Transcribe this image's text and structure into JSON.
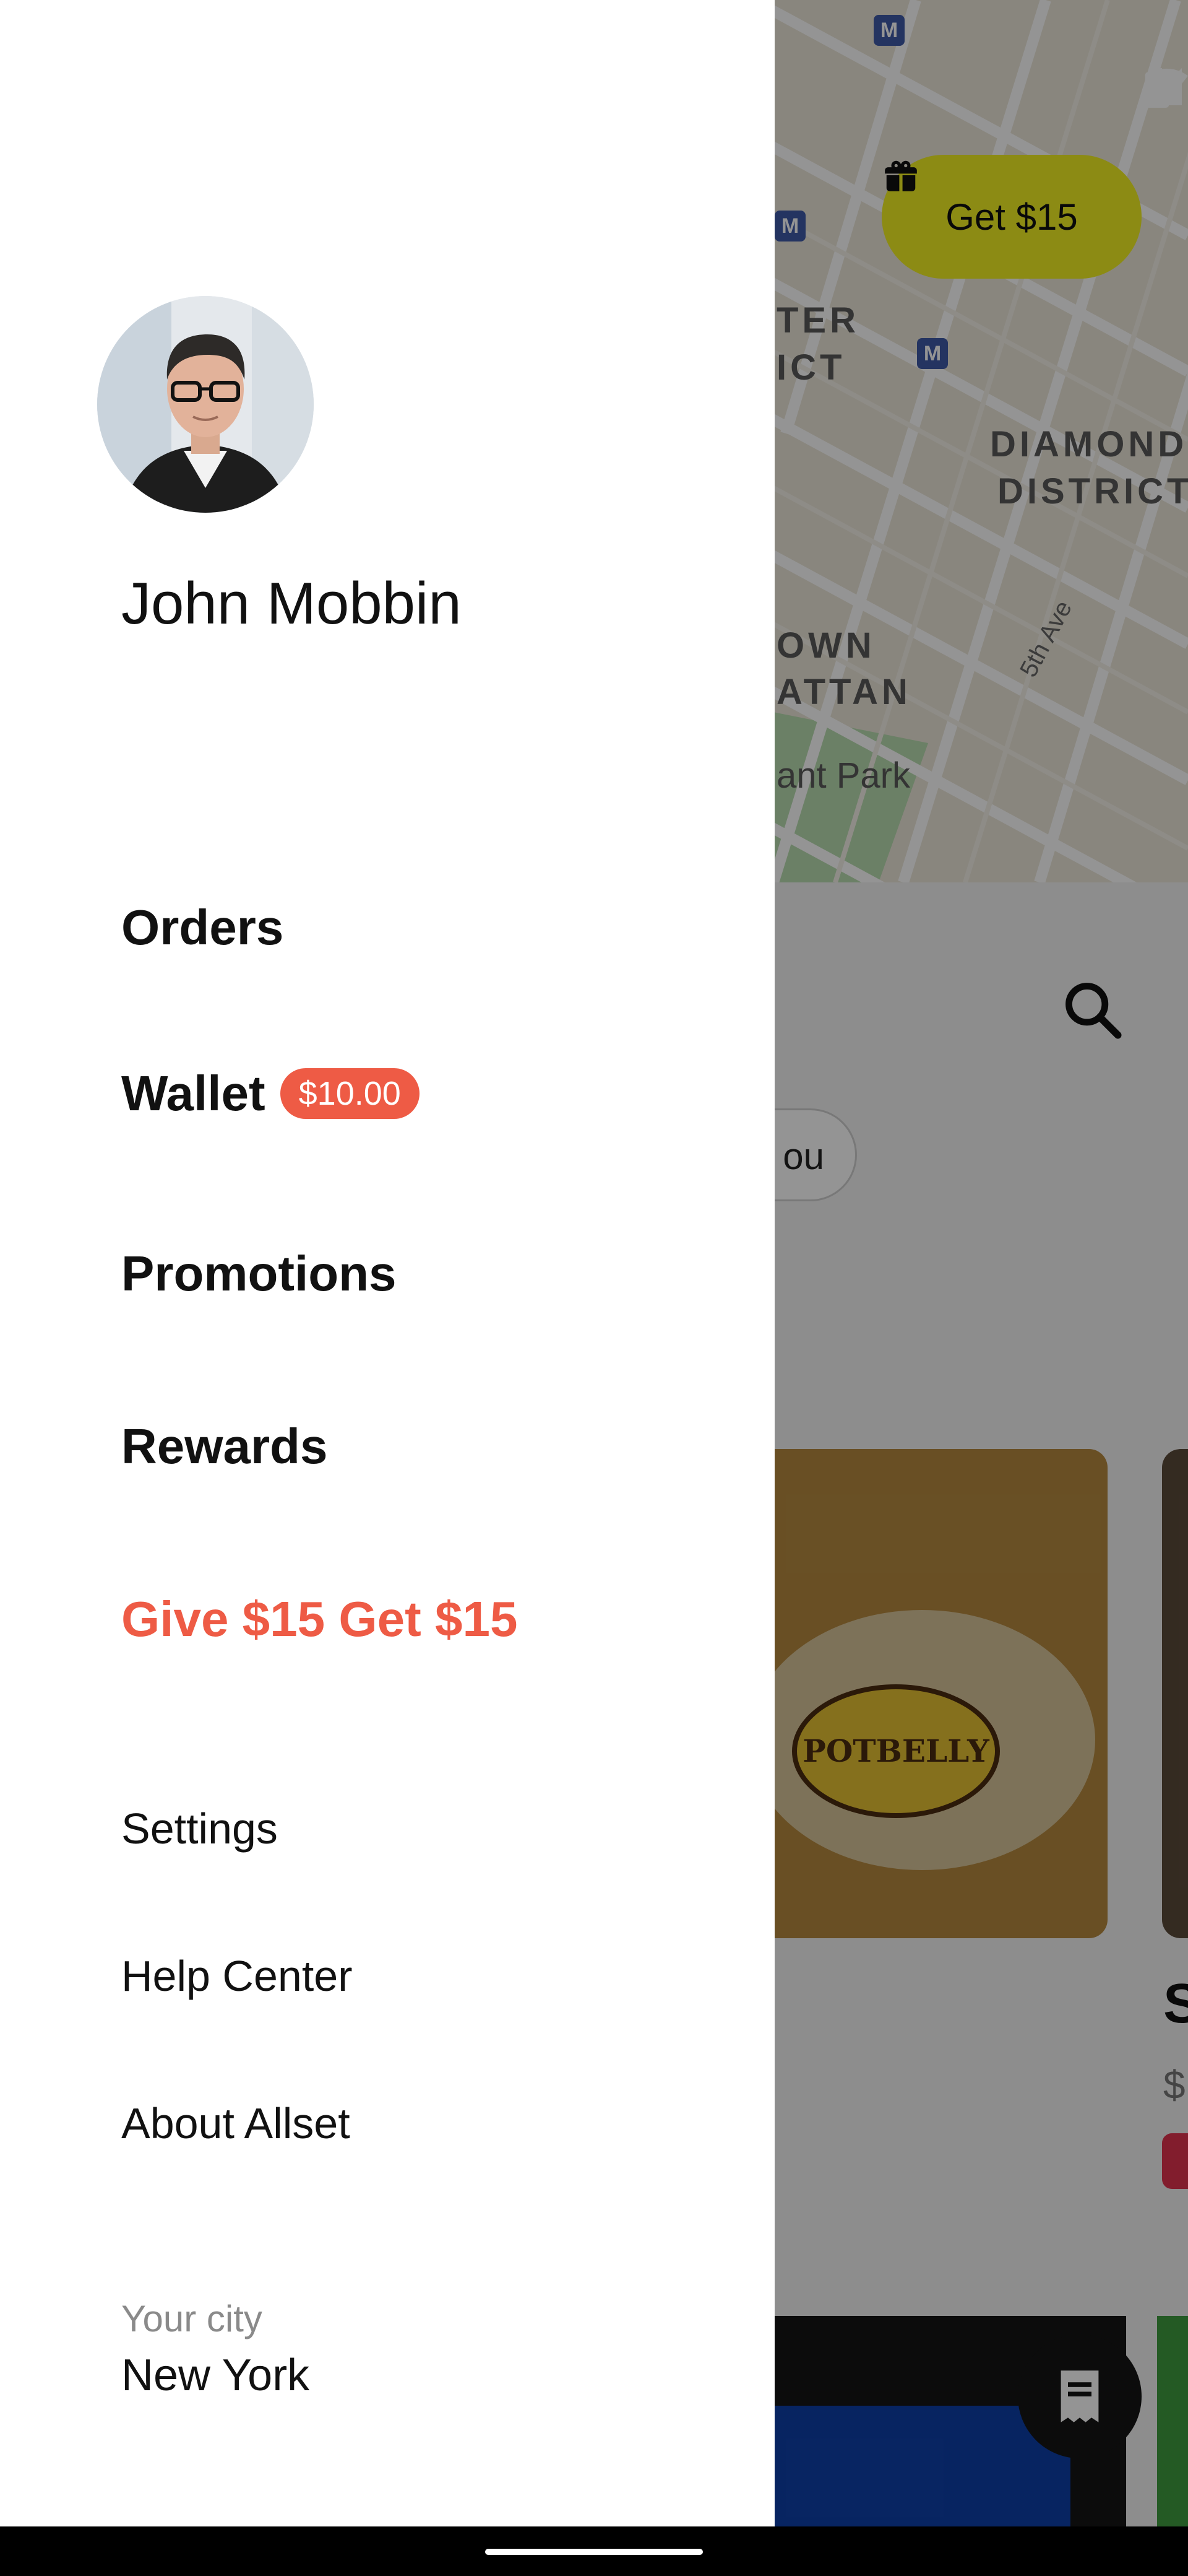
{
  "profile": {
    "name": "John Mobbin"
  },
  "menu": {
    "primary": [
      {
        "key": "orders",
        "label": "Orders"
      },
      {
        "key": "wallet",
        "label": "Wallet",
        "badge": "$10.00"
      },
      {
        "key": "promotions",
        "label": "Promotions"
      },
      {
        "key": "rewards",
        "label": "Rewards"
      }
    ],
    "referral": {
      "label": "Give $15 Get $15"
    },
    "secondary": [
      {
        "key": "settings",
        "label": "Settings"
      },
      {
        "key": "help",
        "label": "Help Center"
      },
      {
        "key": "about",
        "label": "About Allset"
      }
    ]
  },
  "city": {
    "caption": "Your city",
    "value": "New York"
  },
  "background": {
    "promo_pill": "Get $15",
    "map_labels": [
      "TER",
      "ICT",
      "DIAMOND",
      "DISTRICT",
      "OWN",
      "ATTAN",
      "ant Park"
    ],
    "street": "5th Ave",
    "chip_text": "ou",
    "card_logo": "POTBELLY",
    "card_title_partial": "S",
    "card_price_partial": "$"
  },
  "colors": {
    "accent": "#ee5b45",
    "promo_yellow": "#f1ef23",
    "scrim": "rgba(0,0,0,0.42)"
  },
  "icons": {
    "wifi": "wifi-icon",
    "signal": "cell-signal-icon",
    "battery": "battery-icon",
    "gift": "gift-icon",
    "search": "search-icon",
    "receipt": "receipt-icon"
  }
}
